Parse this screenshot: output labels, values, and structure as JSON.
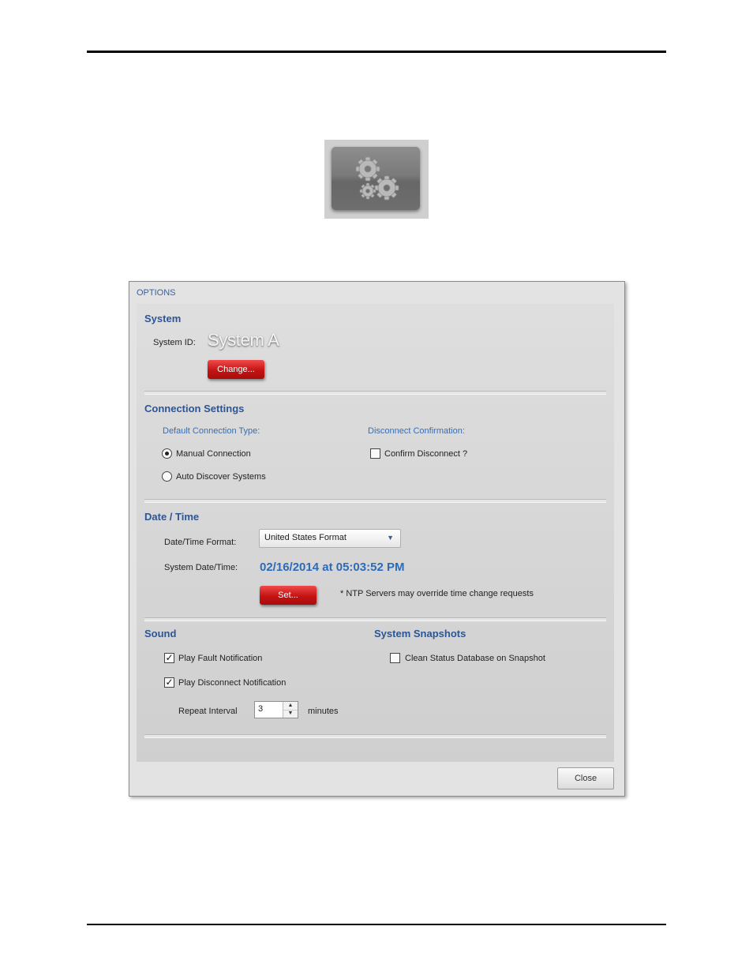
{
  "dialog": {
    "title": "OPTIONS",
    "close_label": "Close"
  },
  "system": {
    "heading": "System",
    "id_label": "System ID:",
    "id_value": "System A",
    "change_label": "Change..."
  },
  "connection": {
    "heading": "Connection Settings",
    "type_label": "Default Connection Type:",
    "manual_label": "Manual Connection",
    "auto_label": "Auto Discover Systems",
    "selected": "Manual Connection",
    "disconnect_label": "Disconnect Confirmation:",
    "confirm_label": "Confirm Disconnect ?",
    "confirm_checked": false
  },
  "datetime": {
    "heading": "Date / Time",
    "format_label": "Date/Time Format:",
    "format_value": "United States Format",
    "system_label": "System Date/Time:",
    "system_value": "02/16/2014 at 05:03:52 PM",
    "set_label": "Set...",
    "ntp_note": "* NTP Servers may override time change requests"
  },
  "sound": {
    "heading": "Sound",
    "fault_label": "Play Fault Notification",
    "fault_checked": true,
    "disconnect_label": "Play Disconnect Notification",
    "disconnect_checked": true,
    "repeat_label": "Repeat Interval",
    "repeat_value": "3",
    "repeat_unit": "minutes"
  },
  "snapshots": {
    "heading": "System Snapshots",
    "clean_label": "Clean Status Database on Snapshot",
    "clean_checked": false
  },
  "icons": {
    "settings": "gears-icon",
    "dropdown": "chevron-down-icon"
  },
  "colors": {
    "accent_blue": "#2c5596",
    "button_red": "#c41313"
  }
}
